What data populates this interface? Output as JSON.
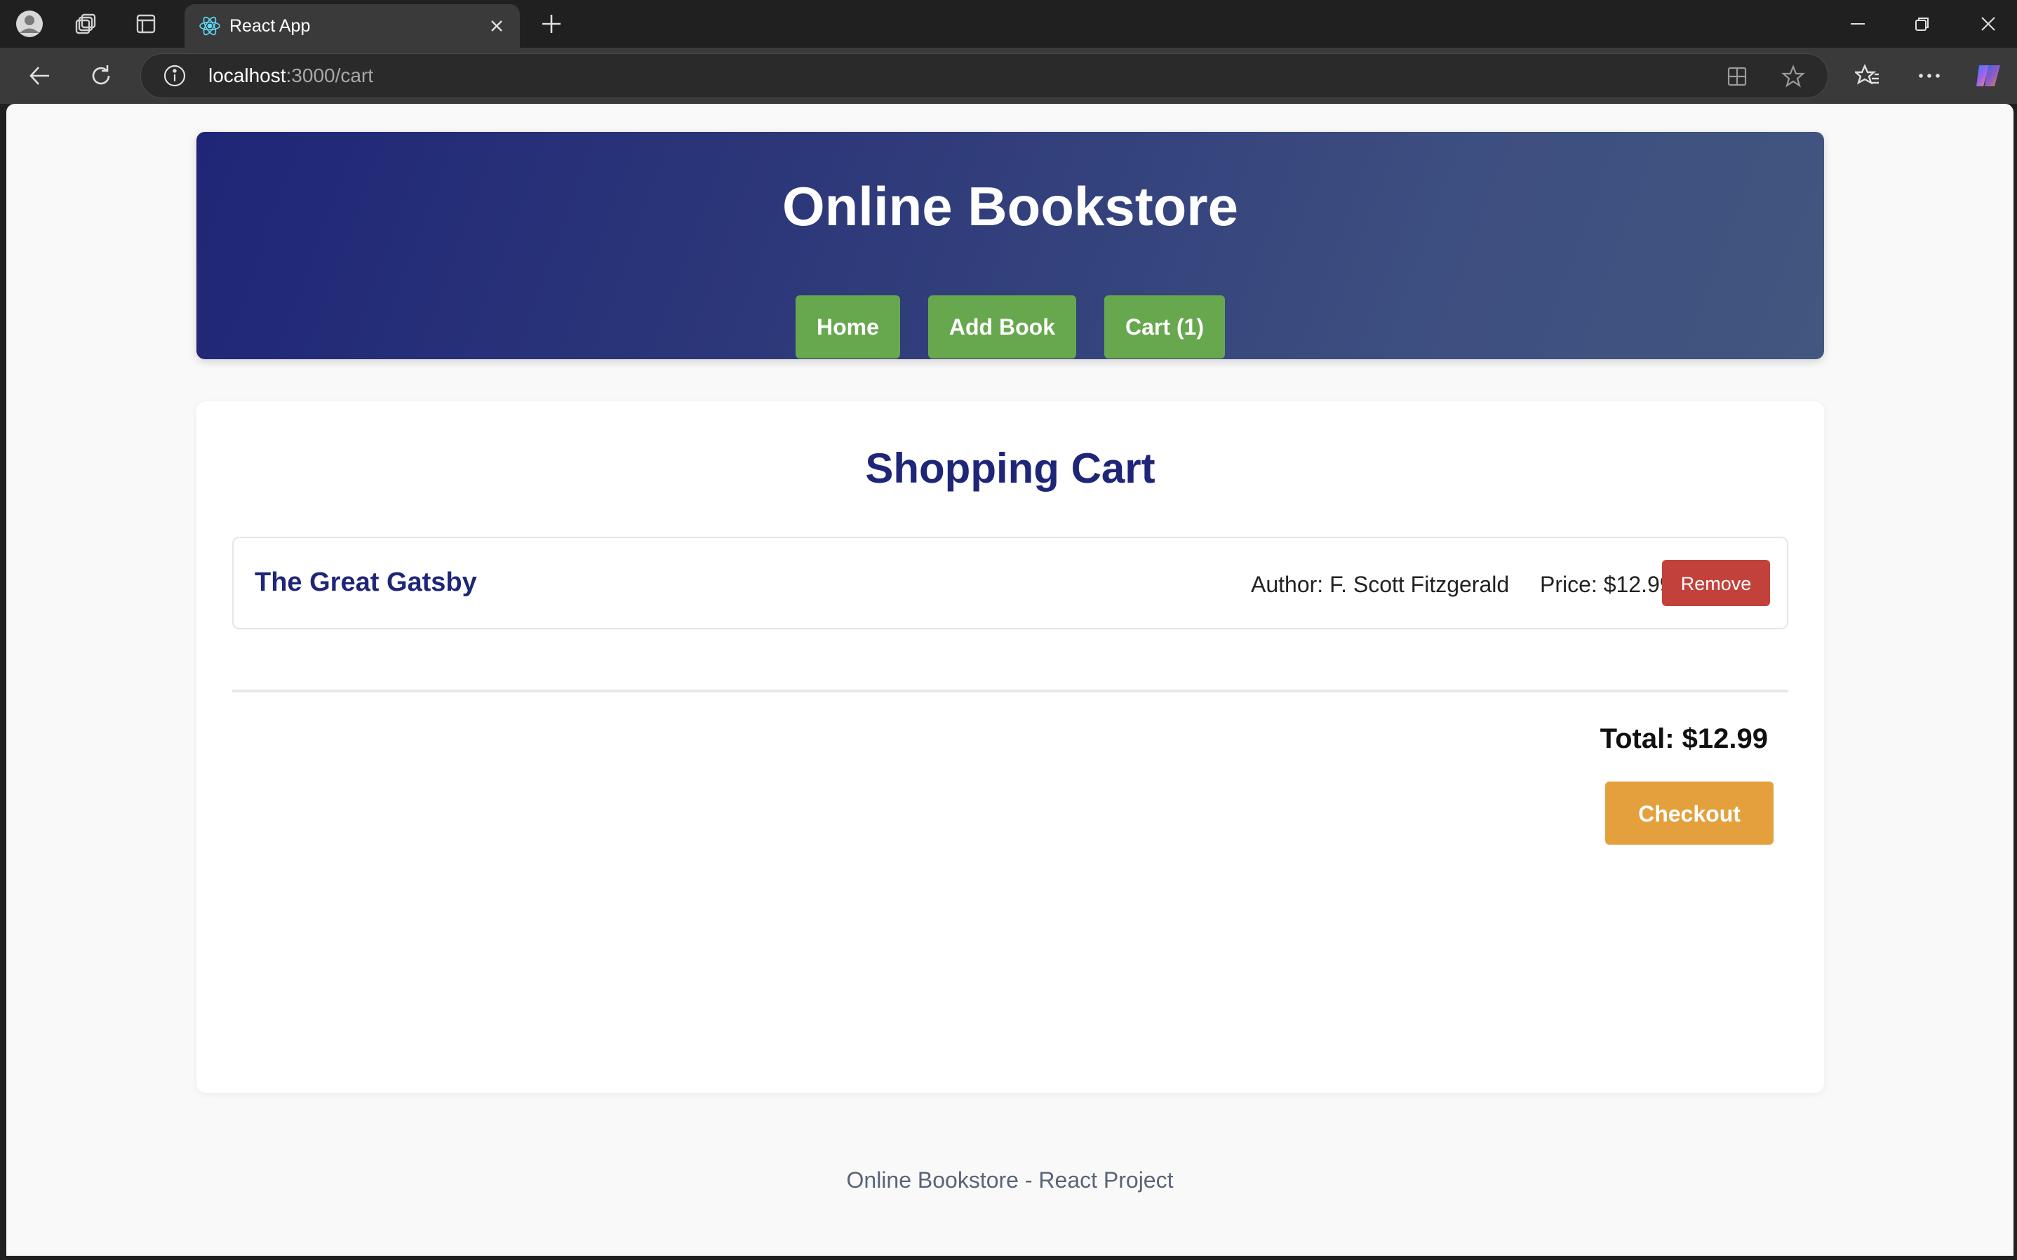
{
  "browser": {
    "tab_title": "React App",
    "url_host": "localhost",
    "url_rest": ":3000/cart"
  },
  "header": {
    "title": "Online Bookstore",
    "nav": [
      {
        "label": "Home"
      },
      {
        "label": "Add Book"
      },
      {
        "label": "Cart (1)"
      }
    ]
  },
  "cart": {
    "title": "Shopping Cart",
    "items": [
      {
        "title": "The Great Gatsby",
        "author": "Author: F. Scott Fitzgerald",
        "price": "Price: $12.99",
        "remove_label": "Remove"
      }
    ],
    "total": "Total: $12.99",
    "checkout_label": "Checkout"
  },
  "footer": {
    "text": "Online Bookstore - React Project"
  },
  "colors": {
    "header_gradient_start": "#1f2677",
    "header_gradient_end": "#42567f",
    "nav_button": "#67a84f",
    "heading": "#1f2677",
    "remove_button": "#c2413b",
    "checkout_button": "#e4a03c"
  }
}
